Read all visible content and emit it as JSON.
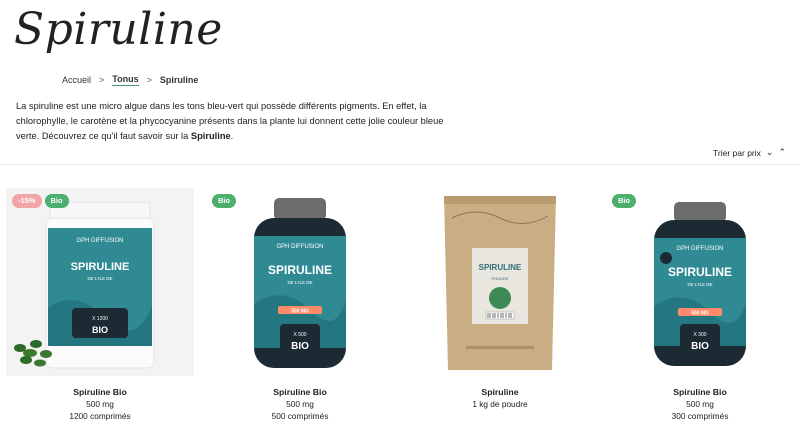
{
  "page": {
    "title": "Spiruline",
    "breadcrumb": [
      "Accueil",
      "Tonus",
      "Spiruline"
    ],
    "intro_a": "La spiruline est une micro algue dans les tons bleu-vert qui possède différents pigments. En effet, la chlorophylle, le carotène et la phycocyanine présents dans la plante lui donnent cette jolie couleur bleue verte. Découvrez ce qu'il faut savoir sur la ",
    "intro_b": "Spiruline",
    "intro_c": "."
  },
  "sort": {
    "label": "Trier par prix"
  },
  "products": [
    {
      "badge1": "-15%",
      "badge2": "Bio",
      "brand": "GPH DIFFUSION",
      "label": "SPIRULINE",
      "sub": "DE L'ILE DE",
      "count": "X 1200",
      "bio_tag": "BIO",
      "name": "Spiruline Bio",
      "l1": "500 mg",
      "l2": "1200 comprimés"
    },
    {
      "badge1": "Bio",
      "brand": "GPH DIFFUSION",
      "label": "SPIRULINE",
      "sub": "DE L'ILE DE",
      "dose": "500 MG",
      "count": "X 500",
      "bio_tag": "BIO",
      "name": "Spiruline Bio",
      "l1": "500 mg",
      "l2": "500 comprimés"
    },
    {
      "label": "SPIRULINE",
      "sub": "POUDRE",
      "name": "Spiruline",
      "l1": "1 kg de poudre"
    },
    {
      "badge1": "Bio",
      "brand": "GPH DIFFUSION",
      "label": "SPIRULINE",
      "sub": "DE L'ILE DE",
      "dose": "500 MG",
      "count": "X 300",
      "bio_tag": "BIO",
      "name": "Spiruline Bio",
      "l1": "500 mg",
      "l2": "300 comprimés"
    }
  ],
  "colors": {
    "teal": "#2f8a94",
    "dark": "#1c2b33",
    "bio_badge": "#4caf6e",
    "discount_badge": "#f3a5a5",
    "kraft": "#c9ae84"
  }
}
